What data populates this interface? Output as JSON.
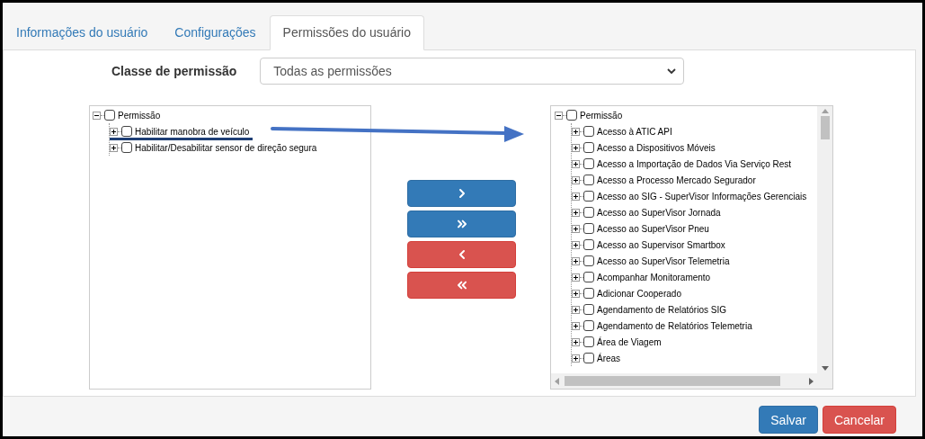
{
  "tabs": [
    {
      "label": "Informações do usuário",
      "selected": false
    },
    {
      "label": "Configurações",
      "selected": false
    },
    {
      "label": "Permissões do usuário",
      "selected": true
    }
  ],
  "permission_class": {
    "label": "Classe de permissão",
    "value": "Todas as permissões"
  },
  "available_tree": [
    {
      "label": "Permissão",
      "checked": false,
      "expanded": true,
      "children": [
        {
          "label": "Habilitar manobra de veículo",
          "checked": false,
          "expanded": false
        },
        {
          "label": "Habilitar/Desabilitar sensor de direção segura",
          "checked": false,
          "expanded": false
        }
      ]
    }
  ],
  "transfer_buttons": [
    {
      "kind": "add"
    },
    {
      "kind": "add_all"
    },
    {
      "kind": "remove"
    },
    {
      "kind": "remove_all"
    }
  ],
  "assigned_tree": [
    {
      "label": "Permissão",
      "checked": false,
      "expanded": true,
      "children": [
        {
          "label": "Acesso à ATIC API",
          "checked": false,
          "expanded": false
        },
        {
          "label": "Acesso a Dispositivos Móveis",
          "checked": false,
          "expanded": false
        },
        {
          "label": "Acesso a Importação de Dados Via Serviço Rest",
          "checked": false,
          "expanded": false
        },
        {
          "label": "Acesso a Processo Mercado Segurador",
          "checked": false,
          "expanded": false
        },
        {
          "label": "Acesso ao SIG - SuperVisor Informações Gerenciais",
          "checked": false,
          "expanded": false
        },
        {
          "label": "Acesso ao SuperVisor Jornada",
          "checked": false,
          "expanded": false
        },
        {
          "label": "Acesso ao SuperVisor Pneu",
          "checked": false,
          "expanded": false
        },
        {
          "label": "Acesso ao Supervisor Smartbox",
          "checked": false,
          "expanded": false
        },
        {
          "label": "Acesso ao SuperVisor Telemetria",
          "checked": false,
          "expanded": false
        },
        {
          "label": "Acompanhar Monitoramento",
          "checked": false,
          "expanded": false
        },
        {
          "label": "Adicionar Cooperado",
          "checked": false,
          "expanded": false
        },
        {
          "label": "Agendamento de Relatórios SIG",
          "checked": false,
          "expanded": false
        },
        {
          "label": "Agendamento de Relatórios Telemetria",
          "checked": false,
          "expanded": false
        },
        {
          "label": "Área de Viagem",
          "checked": false,
          "expanded": false
        },
        {
          "label": "Áreas",
          "checked": false,
          "expanded": false
        }
      ]
    }
  ],
  "footer_buttons": [
    {
      "label": "Salvar",
      "kind": "primary"
    },
    {
      "label": "Cancelar",
      "kind": "danger"
    }
  ]
}
